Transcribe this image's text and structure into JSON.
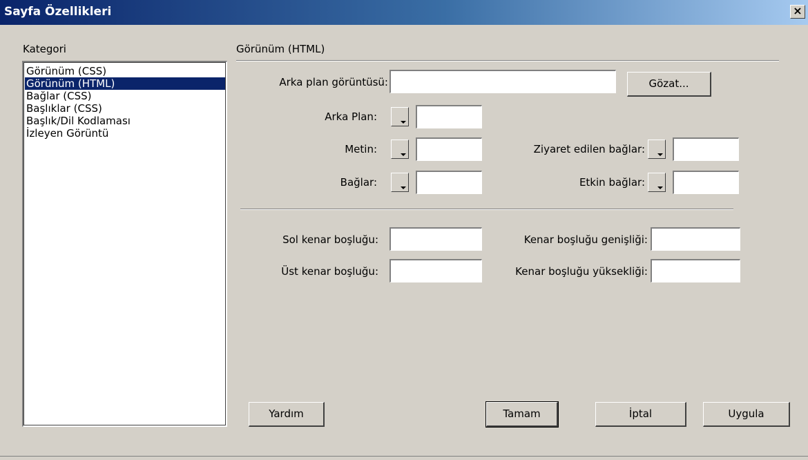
{
  "window": {
    "title": "Sayfa Özellikleri",
    "close_glyph": "×"
  },
  "category": {
    "label": "Kategori",
    "items": [
      "Görünüm (CSS)",
      "Görünüm (HTML)",
      "Bağlar (CSS)",
      "Başlıklar (CSS)",
      "Başlık/Dil Kodlaması",
      "İzleyen Görüntü"
    ],
    "selected_index": 1
  },
  "panel": {
    "title": "Görünüm (HTML)",
    "bg_image_label": "Arka plan görüntüsü:",
    "bg_image_value": "",
    "browse_label": "Gözat...",
    "bg_label": "Arka Plan:",
    "bg_value": "",
    "text_label": "Metin:",
    "text_value": "",
    "links_label": "Bağlar:",
    "links_value": "",
    "visited_label": "Ziyaret edilen bağlar:",
    "visited_value": "",
    "active_label": "Etkin bağlar:",
    "active_value": "",
    "left_margin_label": "Sol kenar boşluğu:",
    "left_margin_value": "",
    "top_margin_label": "Üst kenar boşluğu:",
    "top_margin_value": "",
    "margin_width_label": "Kenar boşluğu genişliği:",
    "margin_width_value": "",
    "margin_height_label": "Kenar boşluğu yüksekliği:",
    "margin_height_value": ""
  },
  "buttons": {
    "help": "Yardım",
    "ok": "Tamam",
    "cancel": "İptal",
    "apply": "Uygula"
  },
  "colors": {
    "title_gradient_start": "#0a246a",
    "title_gradient_end": "#a6caf0",
    "dialog_bg": "#d4d0c8",
    "selection_bg": "#0a246a"
  }
}
